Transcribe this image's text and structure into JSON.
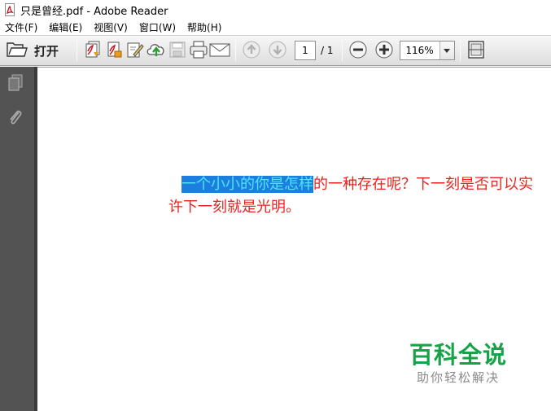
{
  "window": {
    "title": "只是曾经.pdf - Adobe Reader",
    "app_icon": "adobe-pdf-icon"
  },
  "menu": {
    "items": [
      {
        "label": "文件(F)"
      },
      {
        "label": "编辑(E)"
      },
      {
        "label": "视图(V)"
      },
      {
        "label": "窗口(W)"
      },
      {
        "label": "帮助(H)"
      }
    ]
  },
  "toolbar": {
    "open_label": "打开",
    "page_current": "1",
    "page_total": "/ 1",
    "zoom": "116%"
  },
  "document": {
    "line1_highlighted": "一个小小的你是怎样",
    "line1_rest": "的一种存在呢？下一刻是否可以实",
    "line2": "许下一刻就是光明。"
  },
  "watermark": {
    "title": "百科全说",
    "subtitle": "助你轻松解决"
  },
  "colors": {
    "text_red": "#e8241f",
    "highlight_bg": "#1c7fe0",
    "highlight_text": "#4fe3ff",
    "panel": "#535353",
    "watermark_green": "#16a34a"
  }
}
